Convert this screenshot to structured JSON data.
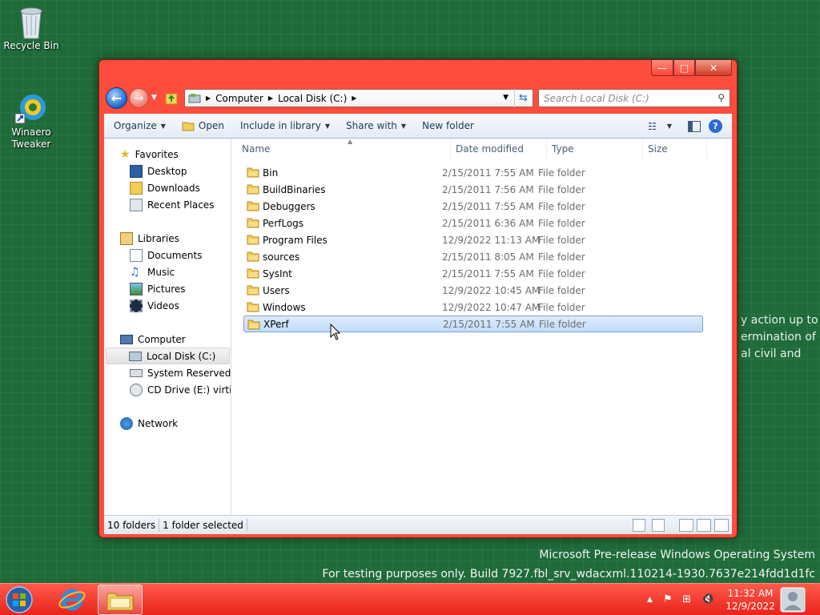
{
  "desktop": {
    "recycle_bin": "Recycle Bin",
    "winaero": "Winaero Tweaker",
    "bg_text_lines": [
      "y action up to",
      "ermination of",
      "al civil and"
    ]
  },
  "watermark": {
    "line1": "Microsoft Pre-release Windows Operating System",
    "line2": "For testing purposes only. Build 7927.fbl_srv_wdacxml.110214-1930.7637e214fdd1d1fc"
  },
  "taskbar": {
    "time": "11:32 AM",
    "date": "12/9/2022"
  },
  "window": {
    "controls": {
      "minimize": "—",
      "maximize": "□",
      "close": "✕"
    },
    "address": {
      "crumbs": [
        "Computer",
        "Local Disk (C:)"
      ]
    },
    "search_placeholder": "Search Local Disk (C:)",
    "toolbar": {
      "organize": "Organize",
      "open": "Open",
      "include": "Include in library",
      "share": "Share with",
      "new_folder": "New folder"
    },
    "columns": {
      "name": "Name",
      "date": "Date modified",
      "type": "Type",
      "size": "Size"
    },
    "nav": {
      "favorites": "Favorites",
      "desktop": "Desktop",
      "downloads": "Downloads",
      "recent": "Recent Places",
      "libraries": "Libraries",
      "documents": "Documents",
      "music": "Music",
      "pictures": "Pictures",
      "videos": "Videos",
      "computer": "Computer",
      "local_disk": "Local Disk (C:)",
      "system_reserved": "System Reserved (D:",
      "cd_drive": "CD Drive (E:) virtio-v",
      "network": "Network"
    },
    "files": [
      {
        "name": "Bin",
        "date": "2/15/2011 7:55 AM",
        "type": "File folder"
      },
      {
        "name": "BuildBinaries",
        "date": "2/15/2011 7:56 AM",
        "type": "File folder"
      },
      {
        "name": "Debuggers",
        "date": "2/15/2011 7:55 AM",
        "type": "File folder"
      },
      {
        "name": "PerfLogs",
        "date": "2/15/2011 6:36 AM",
        "type": "File folder"
      },
      {
        "name": "Program Files",
        "date": "12/9/2022 11:13 AM",
        "type": "File folder"
      },
      {
        "name": "sources",
        "date": "2/15/2011 8:05 AM",
        "type": "File folder"
      },
      {
        "name": "SysInt",
        "date": "2/15/2011 7:55 AM",
        "type": "File folder"
      },
      {
        "name": "Users",
        "date": "12/9/2022 10:45 AM",
        "type": "File folder"
      },
      {
        "name": "Windows",
        "date": "12/9/2022 10:47 AM",
        "type": "File folder"
      },
      {
        "name": "XPerf",
        "date": "2/15/2011 7:55 AM",
        "type": "File folder",
        "selected": true
      }
    ],
    "status": {
      "count": "10 folders",
      "selected": "1 folder selected"
    }
  },
  "colors": {
    "window_frame": "#ff4d3d",
    "taskbar": "#e8231b",
    "desktop": "#1f6b3a",
    "selection": "#c1dcfc"
  }
}
